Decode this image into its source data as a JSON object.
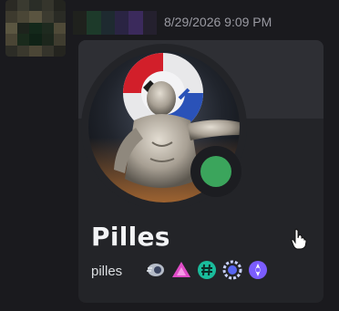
{
  "message": {
    "timestamp": "8/29/2026 9:09 PM"
  },
  "profile": {
    "display_name": "Pilles",
    "username": "pilles",
    "status": "online",
    "status_color": "#3ba55c",
    "badges": [
      {
        "icon": "nitro-orb-icon",
        "color": "#9aa4b5"
      },
      {
        "icon": "pink-triangle-icon",
        "color": "#e04cc8"
      },
      {
        "icon": "hashtag-badge-icon",
        "color": "#1abc9c"
      },
      {
        "icon": "laurel-badge-icon",
        "color": "#5865f2"
      },
      {
        "icon": "quest-badge-icon",
        "color": "#7b5cff"
      }
    ]
  },
  "colors": {
    "background": "#1a1a1e",
    "card": "#232428",
    "text_primary": "#f2f3f5",
    "text_muted": "#9a9aa2"
  }
}
